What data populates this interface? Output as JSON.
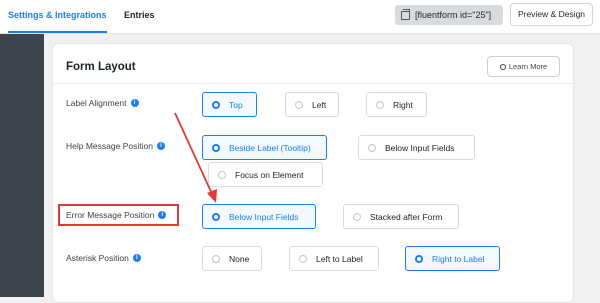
{
  "topbar": {
    "tabs": [
      {
        "label": "Settings & Integrations",
        "active": true
      },
      {
        "label": "Entries",
        "active": false
      }
    ],
    "shortcode": "[fluentform id=\"25\"]",
    "preview_label": "Preview & Design"
  },
  "form_layout": {
    "title": "Form Layout",
    "learn_more_label": "Learn More",
    "rows": [
      {
        "label": "Label Alignment",
        "options": [
          "Top",
          "Left",
          "Right"
        ],
        "selected": "Top"
      },
      {
        "label": "Help Message Position",
        "options": [
          "Beside Label (Tooltip)",
          "Below Input Fields",
          "Focus on Element"
        ],
        "selected": "Beside Label (Tooltip)"
      },
      {
        "label": "Error Message Position",
        "options": [
          "Below Input Fields",
          "Stacked after Form"
        ],
        "selected": "Below Input Fields"
      },
      {
        "label": "Asterisk Position",
        "options": [
          "None",
          "Left to Label",
          "Right to Label"
        ],
        "selected": "Right to Label"
      }
    ]
  },
  "colors": {
    "accent": "#1a7efb",
    "annotation": "#e53935",
    "sidebar": "#3c434a"
  },
  "icons": {
    "info": "info-icon",
    "copy": "copy-icon",
    "learn_more": "globe-icon"
  }
}
